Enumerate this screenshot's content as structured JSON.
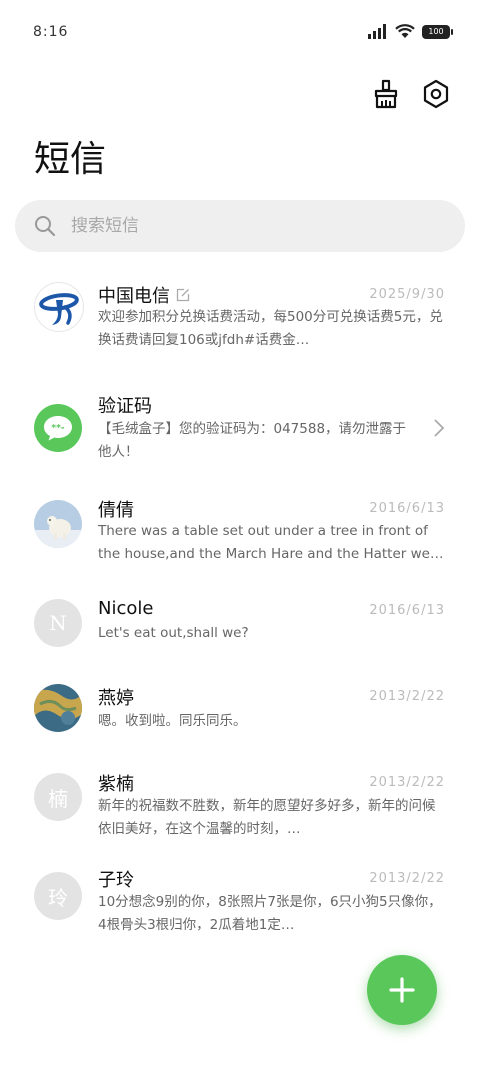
{
  "status": {
    "time": "8:16",
    "battery": "100",
    "signal_icon": "signal-icon",
    "wifi_icon": "wifi-icon",
    "battery_icon": "battery-icon"
  },
  "toolbar": {
    "clean_icon": "broom-icon",
    "settings_icon": "settings-hexagon-icon"
  },
  "page": {
    "title": "短信"
  },
  "search": {
    "placeholder": "搜索短信"
  },
  "conversations": [
    {
      "name": "中国电信",
      "date": "2025/9/30",
      "preview": "欢迎参加积分兑换话费活动，每500分可兑换话费5元，兑换话费请回复106或jfdh#话费金…",
      "avatar": "china-telecom-logo"
    },
    {
      "name": "验证码",
      "date": "",
      "preview": "【毛绒盒子】您的验证码为：047588，请勿泄露于他人！",
      "avatar": "message-bubble-icon"
    },
    {
      "name": "倩倩",
      "date": "2016/6/13",
      "preview": "There was a table set out under a tree in front of the house,and the March Hare and the Hatter were having …",
      "avatar": "polar-bear-photo"
    },
    {
      "name": "Nicole",
      "date": "2016/6/13",
      "preview": "Let's eat out,shall we?",
      "avatar_letter": "N"
    },
    {
      "name": "燕婷",
      "date": "2013/2/22",
      "preview": "嗯。收到啦。同乐同乐。",
      "avatar": "aerial-photo"
    },
    {
      "name": "紫楠",
      "date": "2013/2/22",
      "preview": "新年的祝福数不胜数，新年的愿望好多好多，新年的问候依旧美好，在这个温馨的时刻，…",
      "avatar_letter": "楠"
    },
    {
      "name": "子玲",
      "date": "2013/2/22",
      "preview": "10分想念9别的你，8张照片7张是你，6只小狗5只像你，4根骨头3根归你，2瓜着地1定…",
      "avatar_letter": "玲"
    }
  ],
  "fab": {
    "icon": "plus-icon"
  },
  "colors": {
    "accent": "#5ac75b",
    "telecom_blue": "#1c57a8"
  }
}
